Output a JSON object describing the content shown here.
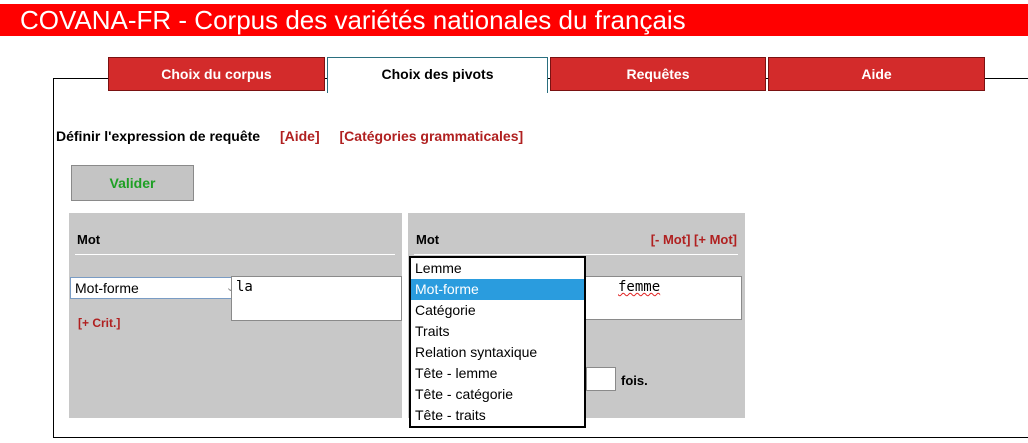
{
  "header": {
    "title": "COVANA-FR - Corpus des variétés nationales du français"
  },
  "tabs": [
    {
      "label": "Choix du corpus"
    },
    {
      "label": "Choix des pivots"
    },
    {
      "label": "Requêtes"
    },
    {
      "label": "Aide"
    }
  ],
  "query": {
    "heading": "Définir l'expression de requête",
    "help_link": "[Aide]",
    "categories_link": "[Catégories grammaticales]"
  },
  "valider_label": "Valider",
  "panel1": {
    "title": "Mot",
    "select_value": "Mot-forme",
    "input_value": "la",
    "add_crit": "[+ Crit.]"
  },
  "panel2": {
    "title": "Mot",
    "remove_word": "[- Mot]",
    "add_word": "[+ Mot]",
    "input_value": "femme",
    "fois_label": "fois."
  },
  "dropdown": {
    "options": [
      "Lemme",
      "Mot-forme",
      "Catégorie",
      "Traits",
      "Relation syntaxique",
      "Tête - lemme",
      "Tête - catégorie",
      "Tête - traits"
    ],
    "selected": "Mot-forme"
  },
  "colors": {
    "title_bar": "#ff0000",
    "tab": "#d32b2b",
    "link": "#b02020",
    "valider_text": "#1ea024",
    "selected_option": "#2a9cde"
  }
}
